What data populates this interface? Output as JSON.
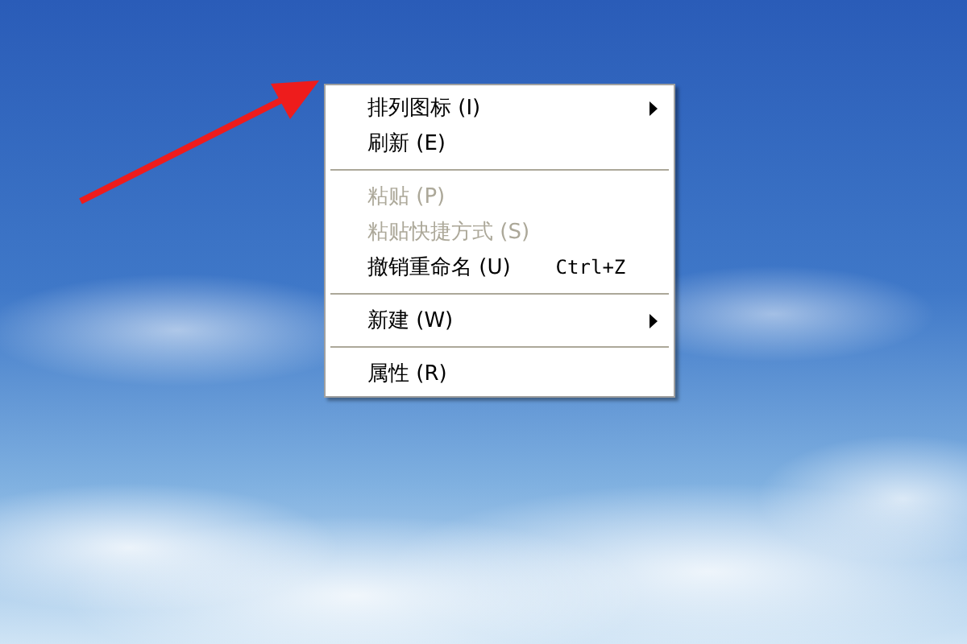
{
  "context_menu": {
    "groups": [
      {
        "items": [
          {
            "label": "排列图标 (I)",
            "has_submenu": true,
            "disabled": false
          },
          {
            "label": "刷新 (E)",
            "has_submenu": false,
            "disabled": false
          }
        ]
      },
      {
        "items": [
          {
            "label": "粘贴 (P)",
            "has_submenu": false,
            "disabled": true
          },
          {
            "label": "粘贴快捷方式 (S)",
            "has_submenu": false,
            "disabled": true
          },
          {
            "label": "撤销重命名 (U)",
            "shortcut": "Ctrl+Z",
            "has_submenu": false,
            "disabled": false
          }
        ]
      },
      {
        "items": [
          {
            "label": "新建 (W)",
            "has_submenu": true,
            "disabled": false
          }
        ]
      },
      {
        "items": [
          {
            "label": "属性 (R)",
            "has_submenu": false,
            "disabled": false
          }
        ]
      }
    ]
  }
}
